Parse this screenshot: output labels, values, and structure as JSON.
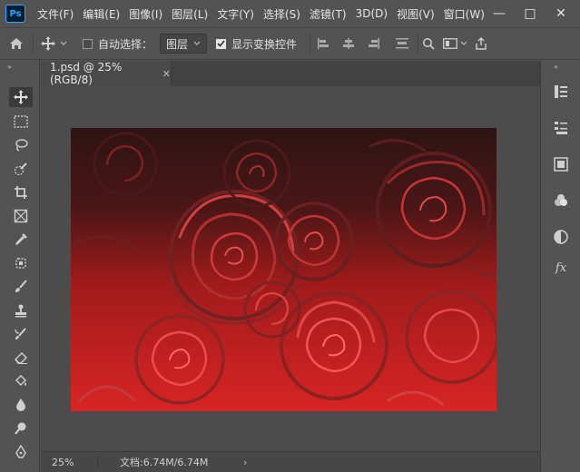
{
  "app": {
    "logo_text": "Ps"
  },
  "menu": [
    "文件(F)",
    "编辑(E)",
    "图像(I)",
    "图层(L)",
    "文字(Y)",
    "选择(S)",
    "滤镜(T)",
    "3D(D)",
    "视图(V)",
    "窗口(W)"
  ],
  "window_controls": {
    "minimize": "—",
    "maximize": "□",
    "close": "✕"
  },
  "options_bar": {
    "auto_select_label": "自动选择：",
    "auto_select_checked": false,
    "auto_select_target": "图层",
    "show_transform_label": "显示变换控件",
    "show_transform_checked": true
  },
  "document": {
    "tab_title": "1.psd @ 25%(RGB/8)",
    "close_glyph": "✕"
  },
  "status": {
    "zoom": "25%",
    "doc_info": "文档:6.74M/6.74M",
    "arrow": "›"
  },
  "colors": {
    "accent": "#31a8ff",
    "ui_bg": "#535353",
    "canvas_bg": "#4c4c4c",
    "image_red": "#c81f1f"
  }
}
